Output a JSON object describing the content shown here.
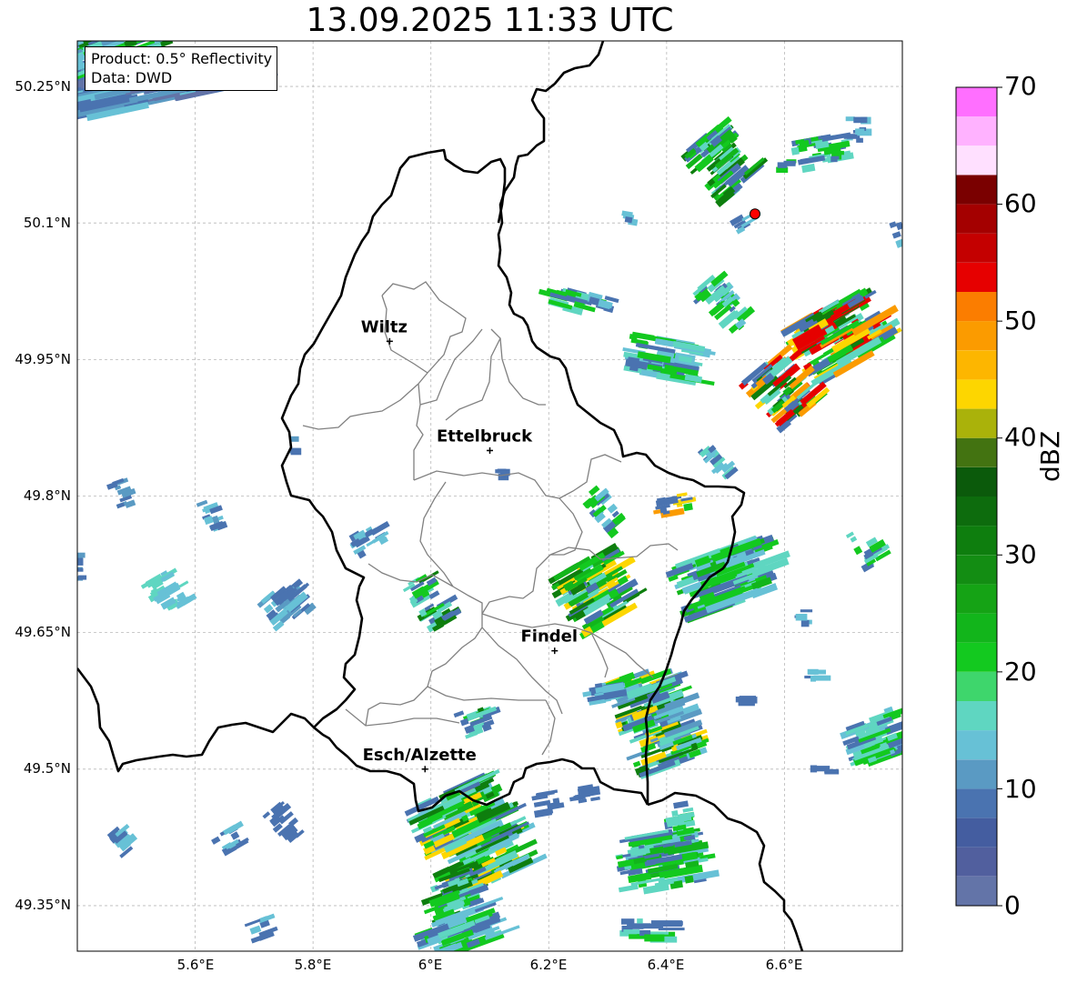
{
  "title": "13.09.2025 11:33 UTC",
  "info_box": {
    "product": "Product: 0.5° Reflectivity",
    "data": "Data: DWD"
  },
  "axes": {
    "lat_labels": [
      "50.25°N",
      "50.1°N",
      "49.95°N",
      "49.8°N",
      "49.65°N",
      "49.5°N",
      "49.35°N"
    ],
    "lon_labels": [
      "5.6°E",
      "5.8°E",
      "6°E",
      "6.2°E",
      "6.4°E",
      "6.6°E"
    ],
    "lat_range": [
      49.3,
      50.3
    ],
    "lon_range": [
      5.4,
      6.8
    ],
    "gridlines": true
  },
  "cities": [
    {
      "name": "Wiltz",
      "lon": 5.93,
      "lat": 49.97
    },
    {
      "name": "Ettelbruck",
      "lon": 6.1,
      "lat": 49.85
    },
    {
      "name": "Findel",
      "lon": 6.21,
      "lat": 49.63
    },
    {
      "name": "Esch/Alzette",
      "lon": 5.99,
      "lat": 49.5
    }
  ],
  "radar_site_marker": {
    "lon": 6.55,
    "lat": 50.11,
    "color": "#ff0000"
  },
  "colorbar": {
    "label": "dBZ",
    "ticks": [
      "0",
      "10",
      "20",
      "30",
      "40",
      "50",
      "60",
      "70"
    ],
    "range": [
      0,
      70
    ],
    "colors": [
      "#6374a8",
      "#515f9e",
      "#445da0",
      "#4a73b0",
      "#5a9ac3",
      "#67c1d6",
      "#5fd6c1",
      "#3ed66c",
      "#13c91f",
      "#12b51b",
      "#15a315",
      "#138d13",
      "#0e7e0e",
      "#0d6c0d",
      "#0b5a0b",
      "#437311",
      "#aab20a",
      "#fdd600",
      "#fdb600",
      "#fb9b00",
      "#fb7d00",
      "#e60000",
      "#c40000",
      "#a40000",
      "#7a0000",
      "#ffe0ff",
      "#ffb2ff",
      "#ff6fff",
      "#eb3aeb"
    ]
  }
}
